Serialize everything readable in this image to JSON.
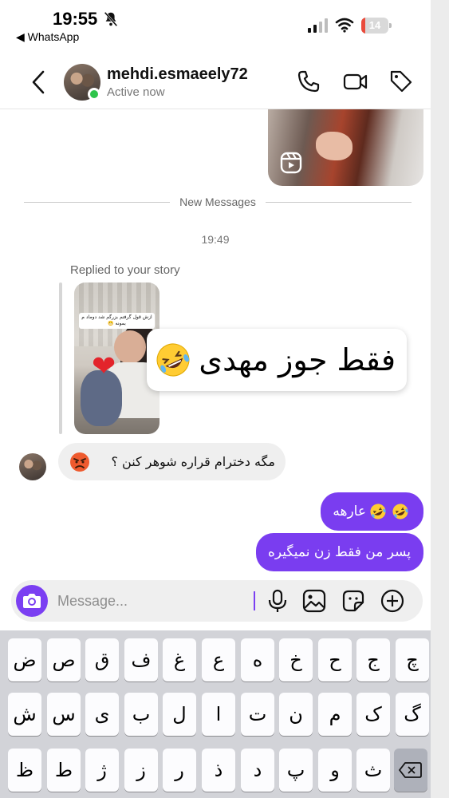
{
  "status_bar": {
    "time": "19:55",
    "back_app": "◀ WhatsApp",
    "battery_percent": 14,
    "battery_label": "14"
  },
  "header": {
    "username": "mehdi.esmaeely72",
    "status": "Active now",
    "icons": [
      "back-chevron-icon",
      "phone-icon",
      "video-camera-icon",
      "tag-icon"
    ]
  },
  "chat": {
    "divider_label": "New Messages",
    "timestamp": "19:49",
    "reply_label": "Replied to your story",
    "story_caption": "ازش قول گرفتم بزرگم شد دوماد م بمونه 😬",
    "story_heart": "❤",
    "sticker_text": "فقط جوز مهدی",
    "incoming_message": "مگه دخترام قراره شوهر کنن ؟",
    "outgoing_messages": [
      {
        "text": "عارهه",
        "emoji_count": 2
      },
      {
        "text": "پسر من فقط زن نمیگیره",
        "emoji_count": 0
      }
    ],
    "colors": {
      "accent": "#7a3df0",
      "incoming_bubble": "#efefef",
      "online": "#2ec44b"
    }
  },
  "composer": {
    "placeholder": "Message...",
    "icons": [
      "camera-icon",
      "microphone-icon",
      "gallery-icon",
      "sticker-icon",
      "plus-icon"
    ]
  },
  "keyboard": {
    "rows": [
      [
        "ض",
        "ص",
        "ق",
        "ف",
        "غ",
        "ع",
        "ه",
        "خ",
        "ح",
        "ج",
        "چ"
      ],
      [
        "ش",
        "س",
        "ی",
        "ب",
        "ل",
        "ا",
        "ت",
        "ن",
        "م",
        "ک",
        "گ"
      ],
      [
        "ظ",
        "ط",
        "ژ",
        "ز",
        "ر",
        "ذ",
        "د",
        "پ",
        "و",
        "ث"
      ]
    ],
    "delete_icon": "backspace-icon"
  }
}
